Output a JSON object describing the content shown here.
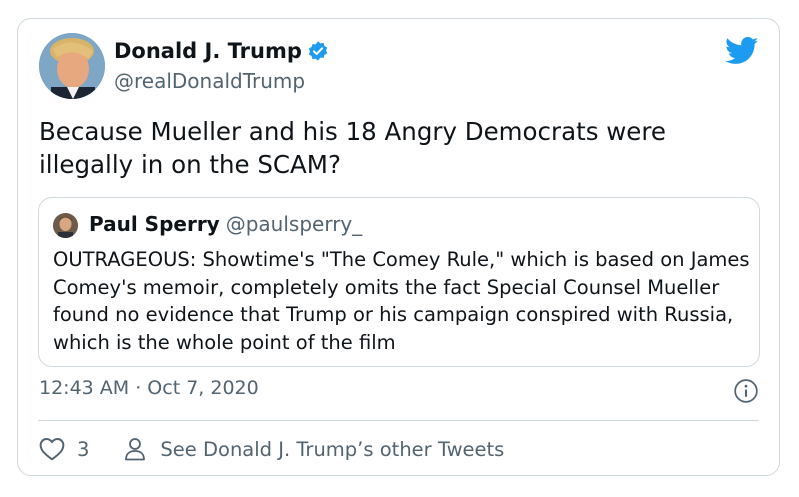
{
  "tweet": {
    "author_name": "Donald J. Trump",
    "handle": "@realDonaldTrump",
    "text": "Because Mueller and his 18 Angry Democrats were illegally in on the SCAM?",
    "timestamp": "12:43 AM · Oct 7, 2020",
    "verified": true
  },
  "quoted_tweet": {
    "author_name": "Paul Sperry",
    "handle": "@paulsperry_",
    "text": "OUTRAGEOUS: Showtime's \"The Comey Rule,\" which is based on James Comey's memoir, completely omits the fact Special Counsel Mueller found no evidence that Trump or his campaign conspired with Russia, which is the whole point of the film"
  },
  "actions": {
    "like_count": "3",
    "other_tweets_label": "See Donald J. Trump’s other Tweets"
  },
  "icons": {
    "brand": "twitter-bird-icon",
    "verified": "verified-badge-icon",
    "info": "info-icon",
    "like": "heart-icon",
    "profile": "person-icon"
  },
  "colors": {
    "brand_blue": "#1d9bf0",
    "text_primary": "#0f1419",
    "text_secondary": "#536471",
    "border": "#cfd9de"
  }
}
